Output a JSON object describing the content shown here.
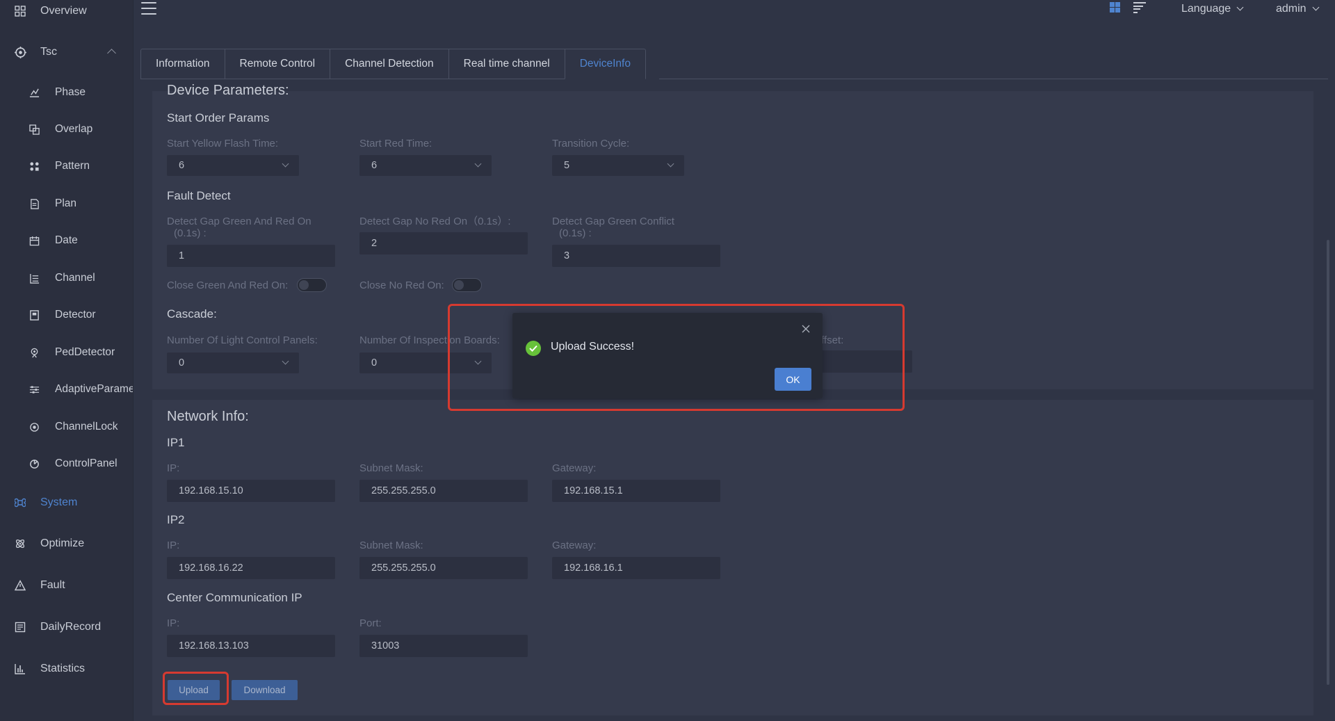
{
  "sidebar": {
    "items": [
      {
        "label": "Overview",
        "icon": "dashboard-grid-icon"
      },
      {
        "label": "Tsc",
        "icon": "signal-controller-icon"
      },
      {
        "label": "Phase",
        "icon": "phase-icon"
      },
      {
        "label": "Overlap",
        "icon": "overlap-icon"
      },
      {
        "label": "Pattern",
        "icon": "pattern-icon"
      },
      {
        "label": "Plan",
        "icon": "plan-icon"
      },
      {
        "label": "Date",
        "icon": "calendar-icon"
      },
      {
        "label": "Channel",
        "icon": "channel-icon"
      },
      {
        "label": "Detector",
        "icon": "detector-icon"
      },
      {
        "label": "PedDetector",
        "icon": "pedestrian-detector-icon"
      },
      {
        "label": "AdaptiveParame",
        "icon": "sliders-icon"
      },
      {
        "label": "ChannelLock",
        "icon": "lock-icon"
      },
      {
        "label": "ControlPanel",
        "icon": "control-panel-icon"
      },
      {
        "label": "System",
        "icon": "command-icon"
      },
      {
        "label": "Optimize",
        "icon": "atom-icon"
      },
      {
        "label": "Fault",
        "icon": "warning-triangle-icon"
      },
      {
        "label": "DailyRecord",
        "icon": "record-icon"
      },
      {
        "label": "Statistics",
        "icon": "bar-chart-icon"
      }
    ]
  },
  "header": {
    "language_label": "Language",
    "user_label": "admin"
  },
  "tabs": [
    {
      "label": "Information"
    },
    {
      "label": "Remote Control"
    },
    {
      "label": "Channel Detection"
    },
    {
      "label": "Real time channel"
    },
    {
      "label": "DeviceInfo"
    }
  ],
  "device": {
    "title": "Device Parameters:",
    "start_order": {
      "title": "Start Order Params",
      "yellow_flash_label": "Start Yellow Flash Time:",
      "yellow_flash_value": "6",
      "red_time_label": "Start Red Time:",
      "red_time_value": "6",
      "transition_label": "Transition Cycle:",
      "transition_value": "5"
    },
    "fault_detect": {
      "title": "Fault Detect",
      "gap_green_red_label_1": "Detect Gap Green And Red On",
      "gap_green_red_label_2": "(0.1s) :",
      "gap_green_red_value": "1",
      "gap_no_red_label": "Detect Gap No Red On（0.1s）:",
      "gap_no_red_value": "2",
      "gap_conflict_label_1": "Detect Gap Green Conflict",
      "gap_conflict_label_2": "(0.1s) :",
      "gap_conflict_value": "3",
      "close_green_red_label": "Close Green And Red On:",
      "close_no_red_label": "Close No Red On:"
    },
    "cascade": {
      "title": "Cascade:",
      "light_panels_label": "Number Of Light Control Panels:",
      "light_panels_value": "0",
      "inspection_label": "Number Of Inspection Boards:",
      "inspection_value": "0",
      "offset_label": "ffset:"
    }
  },
  "network": {
    "title": "Network Info:",
    "ip1": {
      "title": "IP1",
      "ip_label": "IP:",
      "ip_value": "192.168.15.10",
      "mask_label": "Subnet Mask:",
      "mask_value": "255.255.255.0",
      "gateway_label": "Gateway:",
      "gateway_value": "192.168.15.1"
    },
    "ip2": {
      "title": "IP2",
      "ip_label": "IP:",
      "ip_value": "192.168.16.22",
      "mask_label": "Subnet Mask:",
      "mask_value": "255.255.255.0",
      "gateway_label": "Gateway:",
      "gateway_value": "192.168.16.1"
    },
    "center": {
      "title": "Center Communication IP",
      "ip_label": "IP:",
      "ip_value": "192.168.13.103",
      "port_label": "Port:",
      "port_value": "31003"
    },
    "upload_label": "Upload",
    "download_label": "Download"
  },
  "modal": {
    "message": "Upload Success!",
    "ok_label": "OK"
  },
  "colors": {
    "background": "#2f3445",
    "sidebar": "#2b2f3e",
    "accent": "#4f84cf",
    "success": "#67c23a",
    "highlight": "#d63a30"
  }
}
